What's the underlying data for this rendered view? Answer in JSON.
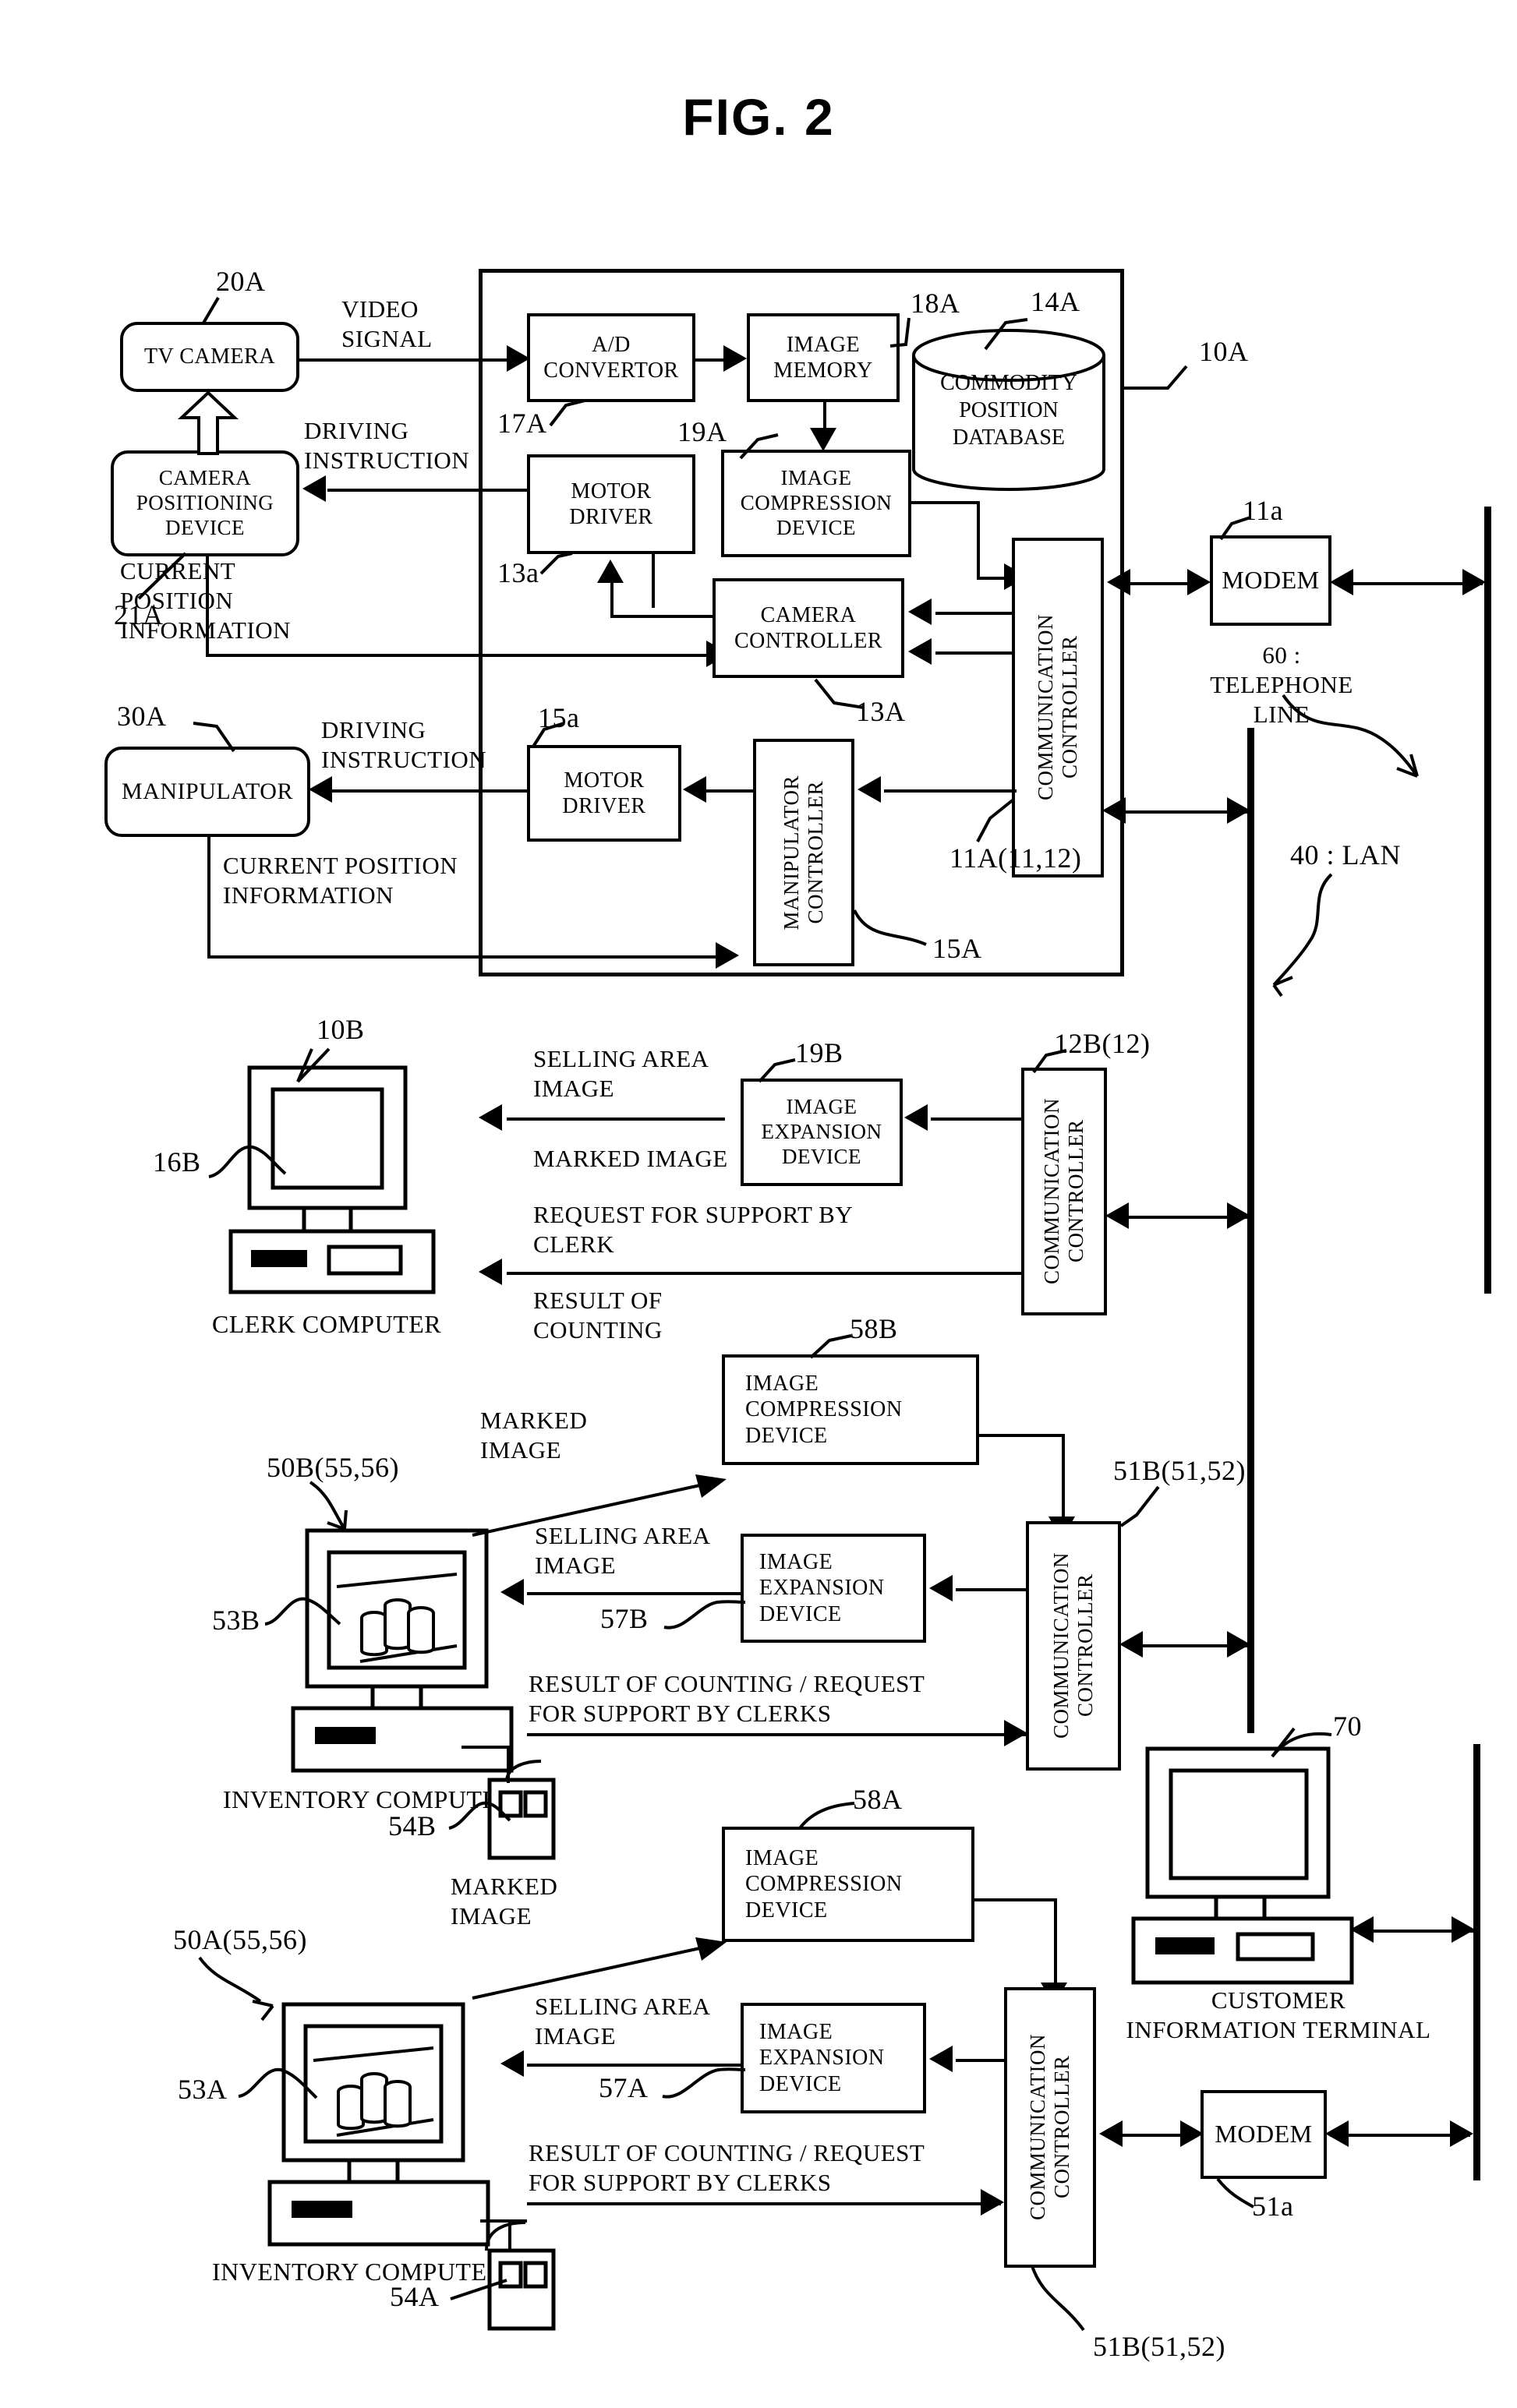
{
  "figure": {
    "title": "FIG. 2"
  },
  "colors": {
    "ink": "#000000",
    "paper": "#ffffff"
  },
  "system_a": {
    "tv_camera": "TV  CAMERA",
    "tv_camera_ref": "20A",
    "camera_positioning_device": "CAMERA\nPOSITIONING\nDEVICE",
    "camera_positioning_ref": "21A",
    "video_signal": "VIDEO\nSIGNAL",
    "driving_instruction_camera": "DRIVING\nINSTRUCTION",
    "current_position_information_camera": "CURRENT\nPOSITION\nINFORMATION",
    "ad_convertor": "A/D\nCONVERTOR",
    "ad_convertor_ref": "17A",
    "image_memory": "IMAGE\nMEMORY",
    "image_memory_ref": "18A",
    "commodity_position_database": "COMMODITY\nPOSITION\nDATABASE",
    "commodity_position_database_ref": "14A",
    "motor_driver_camera": "MOTOR\nDRIVER",
    "motor_driver_camera_ref": "13a",
    "image_compression_device": "IMAGE\nCOMPRESSION\nDEVICE",
    "image_compression_device_ref": "19A",
    "camera_controller": "CAMERA\nCONTROLLER",
    "camera_controller_ref": "13A",
    "communication_controller": "COMMUNICATION\nCONTROLLER",
    "communication_controller_ref": "11A(11,12)",
    "modem": "MODEM",
    "modem_ref": "11a",
    "telephone_line": "60 : TELEPHONE\nLINE",
    "lan": "40 : LAN",
    "enclosure_ref": "10A",
    "manipulator": "MANIPULATOR",
    "manipulator_ref": "30A",
    "driving_instruction_manipulator": "DRIVING\nINSTRUCTION",
    "current_position_information_manipulator": "CURRENT POSITION\nINFORMATION",
    "motor_driver_manipulator": "MOTOR\nDRIVER",
    "motor_driver_manipulator_ref": "15a",
    "manipulator_controller": "MANIPULATOR\nCONTROLLER",
    "manipulator_controller_ref": "15A"
  },
  "clerk": {
    "computer_caption": "CLERK COMPUTER",
    "computer_ref": "10B",
    "display_ref": "16B",
    "selling_area_image": "SELLING AREA\nIMAGE",
    "marked_image": "MARKED IMAGE",
    "request_for_support": "REQUEST FOR SUPPORT BY\nCLERK",
    "result_of_counting": "RESULT OF\nCOUNTING",
    "image_expansion_device": "IMAGE\nEXPANSION\nDEVICE",
    "image_expansion_device_ref": "19B",
    "communication_controller": "COMMUNICATION\nCONTROLLER",
    "communication_controller_ref": "12B(12)"
  },
  "inventory_b": {
    "computer_caption": "INVENTORY COMPUTER",
    "computer_ref": "50B(55,56)",
    "display_ref": "53B",
    "scanner_ref": "54B",
    "marked_image": "MARKED\nIMAGE",
    "selling_area_image": "SELLING AREA\nIMAGE",
    "result_request": "RESULT OF COUNTING / REQUEST\nFOR SUPPORT BY CLERKS",
    "image_compression_device": "IMAGE\nCOMPRESSION\nDEVICE",
    "image_compression_device_ref": "58B",
    "image_expansion_device": "IMAGE\nEXPANSION\nDEVICE",
    "image_expansion_device_ref": "57B",
    "communication_controller": "COMMUNICATION\nCONTROLLER",
    "communication_controller_ref": "51B(51,52)"
  },
  "inventory_a": {
    "computer_caption": "INVENTORY COMPUTER",
    "computer_ref": "50A(55,56)",
    "display_ref": "53A",
    "scanner_ref": "54A",
    "marked_image": "MARKED\nIMAGE",
    "selling_area_image": "SELLING AREA\nIMAGE",
    "result_request": "RESULT OF COUNTING / REQUEST\nFOR SUPPORT BY CLERKS",
    "image_compression_device": "IMAGE\nCOMPRESSION\nDEVICE",
    "image_compression_device_ref": "58A",
    "image_expansion_device": "IMAGE\nEXPANSION\nDEVICE",
    "image_expansion_device_ref": "57A",
    "communication_controller": "COMMUNICATION\nCONTROLLER",
    "communication_controller_ref": "51B(51,52)"
  },
  "customer": {
    "terminal_caption": "CUSTOMER\nINFORMATION  TERMINAL",
    "terminal_ref": "70",
    "modem": "MODEM",
    "modem_ref": "51a"
  }
}
